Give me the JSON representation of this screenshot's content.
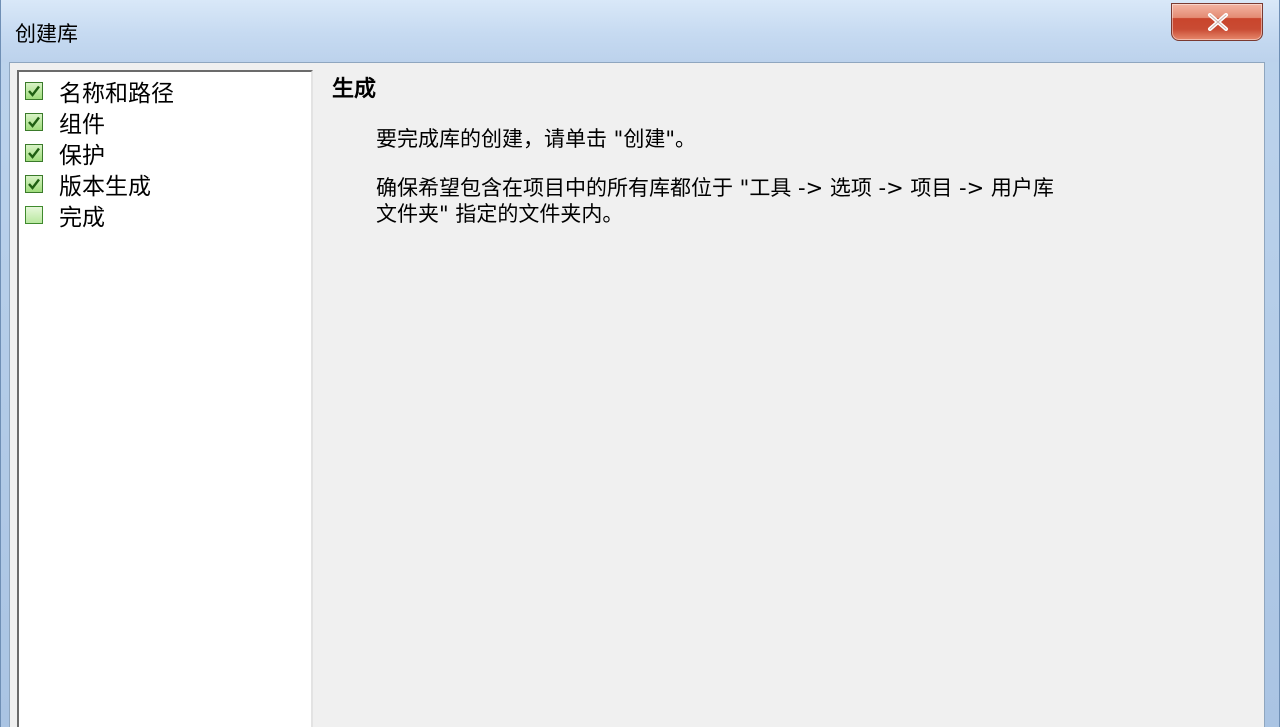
{
  "window": {
    "title": "创建库"
  },
  "nav": {
    "items": [
      {
        "label": "名称和路径",
        "checked": true
      },
      {
        "label": "组件",
        "checked": true
      },
      {
        "label": "保护",
        "checked": true
      },
      {
        "label": "版本生成",
        "checked": true
      },
      {
        "label": "完成",
        "checked": false
      }
    ]
  },
  "content": {
    "heading": "生成",
    "instruction": "要完成库的创建，请单击 \"创建\"。",
    "note_line1": "确保希望包含在项目中的所有库都位于 \"工具 -> 选项 -> 项目 -> 用户库",
    "note_line2": "文件夹\" 指定的文件夹内。"
  },
  "colors": {
    "checkbox_green": "#4caf2a",
    "close_red": "#c9452c"
  },
  "icons": {
    "close": "close-icon",
    "check": "checkmark-icon"
  }
}
